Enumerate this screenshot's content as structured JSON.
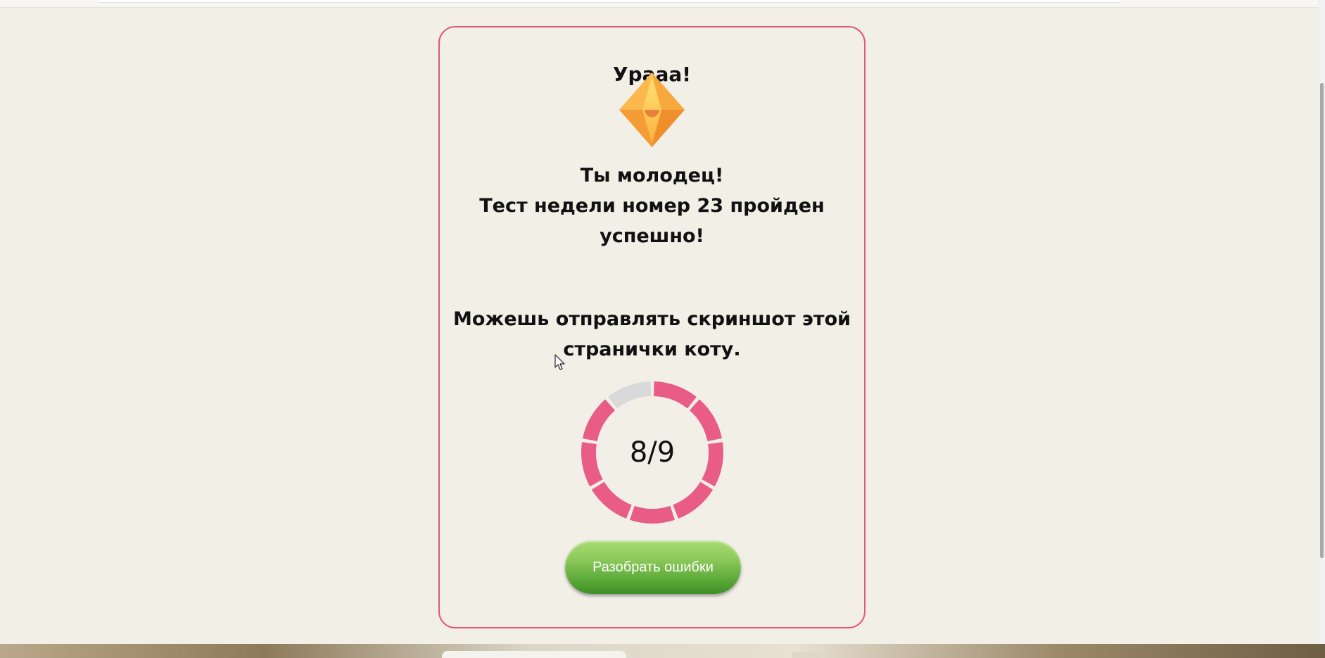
{
  "result": {
    "hooray": "Урааа!",
    "praise_line_1": "Ты молодец!",
    "praise_line_2": "Тест недели номер 23 пройден",
    "praise_line_3": "успешно!",
    "screenshot_note_line_1": "Можешь отправлять скриншот этой",
    "screenshot_note_line_2": "странички коту."
  },
  "score": {
    "text": "8/9",
    "correct": 8,
    "total": 9
  },
  "review_button": {
    "label": "Разобрать ошибки"
  },
  "icons": {
    "badge": "crystal-icon",
    "pointer": "mouse-cursor-icon"
  },
  "colors": {
    "accent": "#e0577c",
    "ring_filled": "#e85c85",
    "ring_empty": "#d9d9d9",
    "button_green": "#5aa839",
    "background": "#f2efe7"
  }
}
